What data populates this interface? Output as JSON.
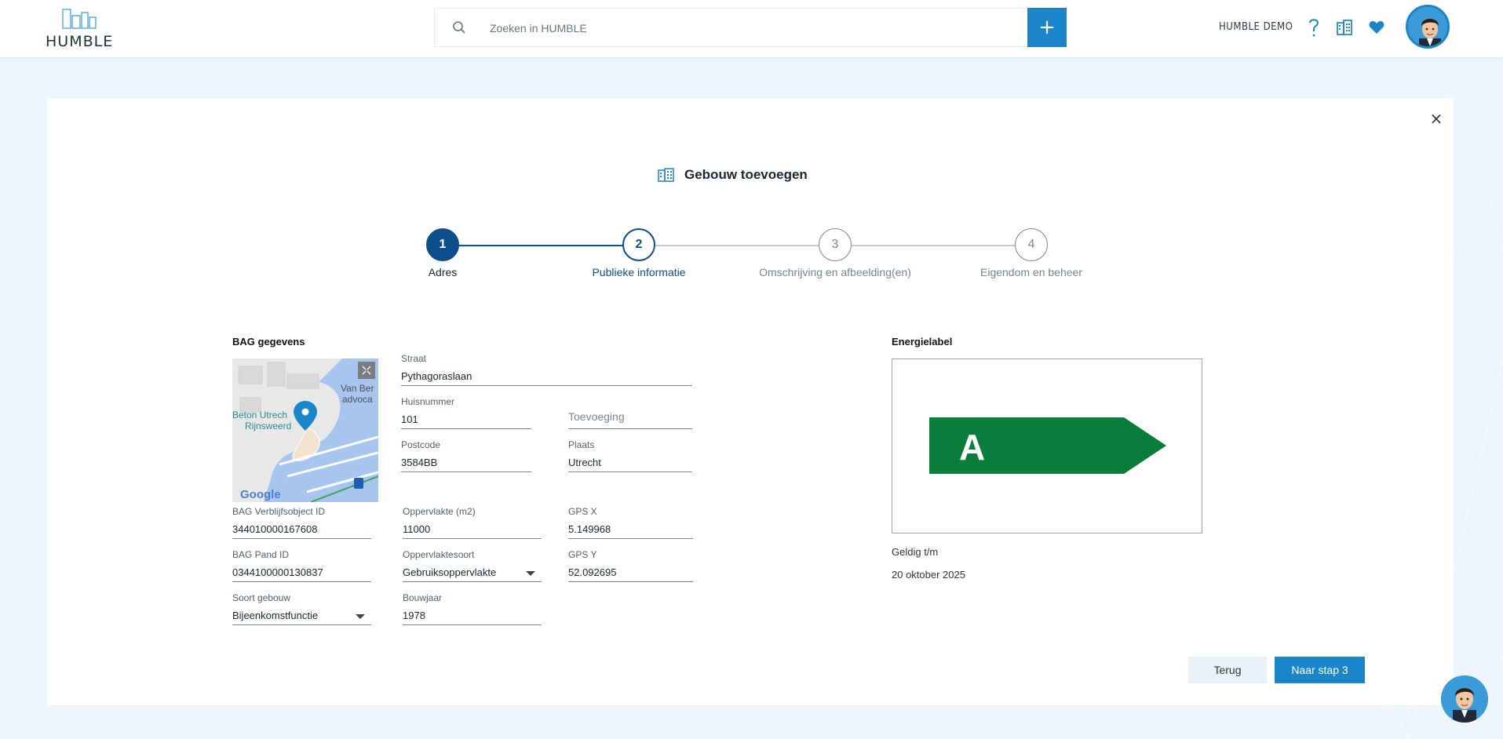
{
  "header": {
    "logo_text": "HUMBLE",
    "search_placeholder": "Zoeken in HUMBLE",
    "add_button": "+",
    "account_label": "HUMBLE DEMO",
    "help_icon": "question-icon",
    "buildings_icon": "buildings-icon",
    "favorites_icon": "heart-icon",
    "accent_color": "#1a86c9"
  },
  "dialog": {
    "title": "Gebouw toevoegen",
    "close": "×",
    "steps": [
      {
        "number": "1",
        "label": "Adres",
        "state": "completed"
      },
      {
        "number": "2",
        "label": "Publieke informatie",
        "state": "active"
      },
      {
        "number": "3",
        "label": "Omschrijving en afbeelding(en)",
        "state": "pending"
      },
      {
        "number": "4",
        "label": "Eigendom en beheer",
        "state": "pending"
      }
    ]
  },
  "bag": {
    "section_title": "BAG gegevens",
    "map": {
      "labels": [
        "Van Ber",
        "advoca",
        "Beton Utrech",
        "Rijnsweerd",
        "Google"
      ]
    },
    "straat": {
      "label": "Straat",
      "value": "Pythagoraslaan"
    },
    "huisnummer": {
      "label": "Huisnummer",
      "value": "101"
    },
    "toevoeging": {
      "placeholder": "Toevoeging"
    },
    "postcode": {
      "label": "Postcode",
      "value": "3584BB"
    },
    "plaats": {
      "label": "Plaats",
      "value": "Utrecht"
    },
    "verblijfsobject_id": {
      "label": "BAG Verblijfsobject ID",
      "value": "344010000167608"
    },
    "oppervlakte": {
      "label": "Oppervlakte (m2)",
      "value": "11000"
    },
    "gps_x": {
      "label": "GPS X",
      "value": "5.149968"
    },
    "pand_id": {
      "label": "BAG Pand ID",
      "value": "0344100000130837"
    },
    "oppervlaktesoort": {
      "label": "Oppervlaktesoort",
      "value": "Gebruiksoppervlakte"
    },
    "gps_y": {
      "label": "GPS Y",
      "value": "52.092695"
    },
    "soort_gebouw": {
      "label": "Soort gebouw",
      "value": "Bijeenkomstfunctie"
    },
    "bouwjaar": {
      "label": "Bouwjaar",
      "value": "1978"
    }
  },
  "energy": {
    "section_title": "Energielabel",
    "label": "A",
    "label_color": "#0a7c3c",
    "valid_until_label": "Geldig t/m",
    "valid_until_value": "20 oktober 2025"
  },
  "buttons": {
    "back": "Terug",
    "next": "Naar stap 3"
  }
}
